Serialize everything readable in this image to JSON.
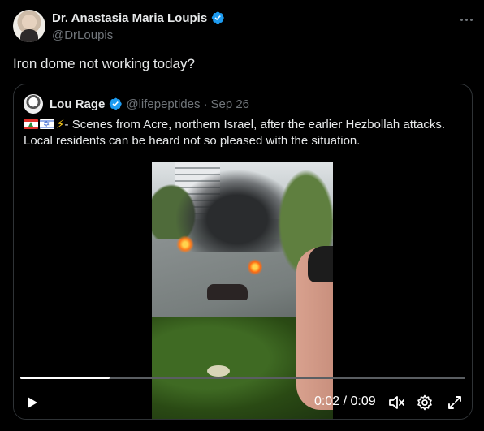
{
  "post": {
    "author": {
      "display_name": "Dr. Anastasia Maria Loupis",
      "handle": "@DrLoupis",
      "verified": true
    },
    "text": "Iron dome not working today?",
    "more_icon": "more-horizontal-icon"
  },
  "quote": {
    "author": {
      "display_name": "Lou Rage",
      "handle": "@lifepeptides",
      "separator": "·",
      "date": "Sep 26",
      "verified": true
    },
    "emoji": [
      "lebanon-flag",
      "israel-flag",
      "⚡"
    ],
    "text": "- Scenes from Acre, northern Israel, after the earlier Hezbollah attacks. Local residents can be heard not so pleased with the situation."
  },
  "video": {
    "progress": 0.2,
    "time_text": "0:02 / 0:09",
    "controls": {
      "play_icon": "play-icon",
      "mute_icon": "volume-muted-icon",
      "settings_icon": "settings-gear-icon",
      "fullscreen_icon": "fullscreen-icon"
    }
  },
  "colors": {
    "background": "#000000",
    "text_primary": "#e7e9ea",
    "text_secondary": "#71767b",
    "verified_blue": "#1d9bf0",
    "border": "#2f3336"
  }
}
